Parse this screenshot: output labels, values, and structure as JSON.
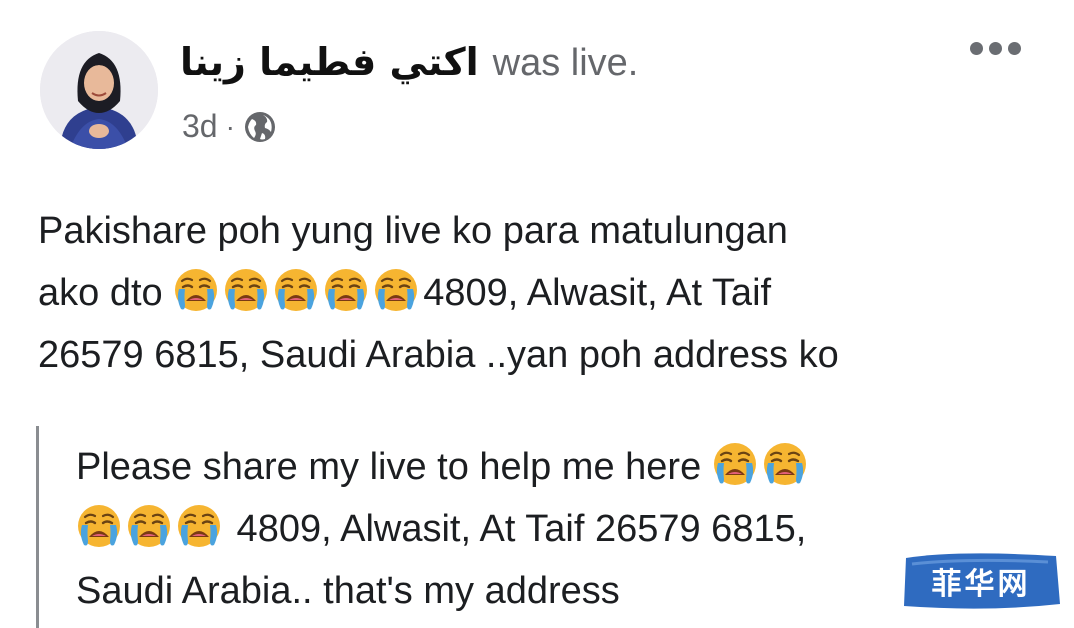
{
  "post": {
    "author_name": "اكتي فطيما زينا",
    "action": "was live.",
    "time": "3d",
    "separator": "·",
    "privacy_icon": "globe-icon",
    "more_icon": "more-options-icon"
  },
  "body": {
    "line1": "Pakishare poh yung live ko para matulungan",
    "line2_prefix": "ako dto ",
    "line2_suffix": "4809, Alwasit, At Taif",
    "line3": "26579 6815, Saudi Arabia ..yan poh address ko",
    "emoji": "loudly-crying-face-emoji"
  },
  "translation": {
    "line1": "Please share my live to help me here ",
    "line2": " 4809, Alwasit, At Taif 26579 6815,",
    "line3": "Saudi Arabia.. that's my address"
  },
  "watermark": {
    "text": "菲华网",
    "color": "#2f6bc0"
  },
  "colors": {
    "text": "#1c1e21",
    "secondary": "#65676b",
    "emoji_face": "#f7b733",
    "emoji_tear": "#4aa3df"
  }
}
